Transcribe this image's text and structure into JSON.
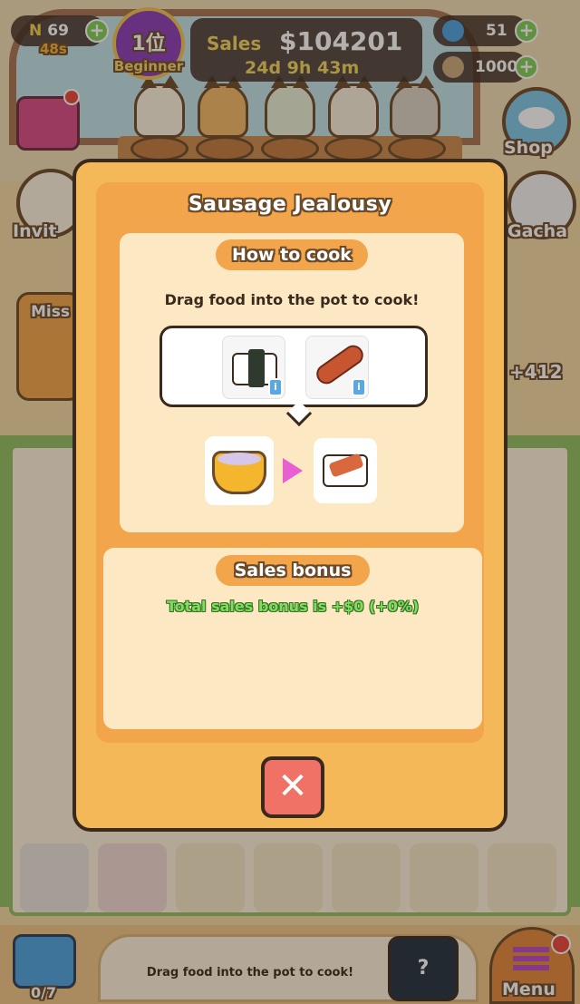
{
  "hud": {
    "energy": "69",
    "energy_timer": "48s",
    "rank": "1位",
    "rank_level": "Beginner",
    "sales_label": "Sales",
    "sales_value": "$104201",
    "time_remaining": "24d 9h 43m",
    "gems": "51",
    "coins": "1000"
  },
  "side": {
    "shop": "Shop",
    "gacha": "Gacha",
    "invite": "Invit",
    "mission": "Miss",
    "count_right": "+412"
  },
  "modal": {
    "title": "Sausage Jealousy",
    "how_to_cook": "How to cook",
    "instruction": "Drag food into the pot to cook!",
    "sales_bonus": "Sales bonus",
    "bonus_text": "Total sales bonus is +$0 (+0%)",
    "close": "✕"
  },
  "bottom": {
    "bag_count": "0/7",
    "hint": "Drag food into the pot to cook!",
    "help": "?",
    "menu": "Menu"
  },
  "colors": {
    "panel": "#f5b858",
    "panel_inner": "#f2a54a",
    "card": "#fde8c4",
    "close": "#f07166",
    "bonus_green": "#7de05b"
  }
}
